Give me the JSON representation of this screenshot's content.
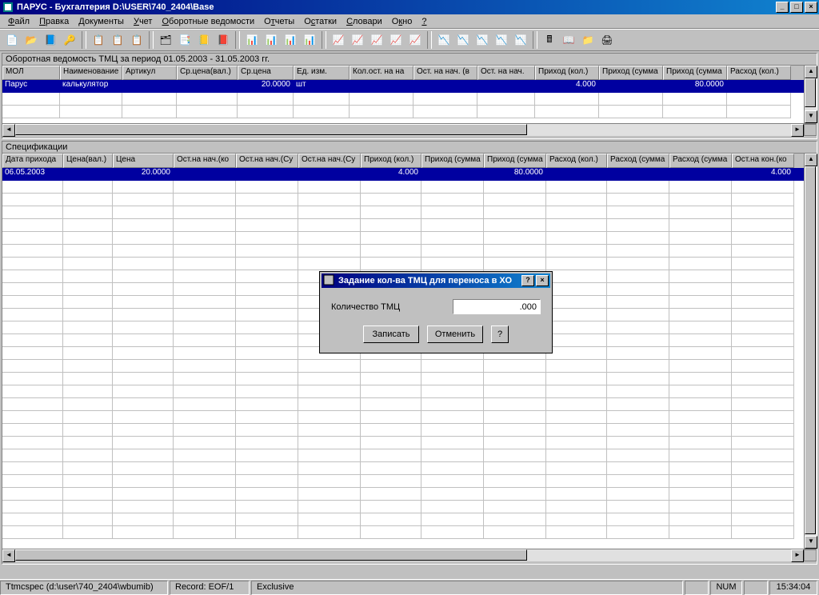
{
  "window": {
    "title": "ПАРУС - Бухгалтерия  D:\\USER\\740_2404\\Base"
  },
  "menu": {
    "file": "Файл",
    "edit": "Правка",
    "documents": "Документы",
    "accounting": "Учет",
    "turnover": "Оборотные ведомости",
    "reports": "Отчеты",
    "balances": "Остатки",
    "dictionaries": "Словари",
    "window": "Окно",
    "help": "?"
  },
  "panel1": {
    "title": "Оборотная ведомость ТМЦ за период 01.05.2003 - 31.05.2003 гг.",
    "columns": [
      "МОЛ",
      "Наименование",
      "Артикул",
      "Ср.цена(вал.)",
      "Ср.цена",
      "Ед. изм.",
      "Кол.ост. на на",
      "Ост. на нач. (в",
      "Ост. на нач.",
      "Приход (кол.)",
      "Приход (сумма",
      "Приход (сумма",
      "Расход (кол.)"
    ],
    "row": {
      "mol": "Парус",
      "name": "калькулятор",
      "artikul": "",
      "avgpricecur": "",
      "avgprice": "20.0000",
      "unit": "шт",
      "qtystart": "",
      "startcur": "",
      "start": "",
      "incqty": "4.000",
      "incsumcur": "",
      "incsum": "80.0000",
      "outqty": ""
    }
  },
  "panel2": {
    "title": "Спецификации",
    "columns": [
      "Дата прихода",
      "Цена(вал.)",
      "Цена",
      "Ост.на нач.(ко",
      "Ост.на нач.(Су",
      "Ост.на нач.(Су",
      "Приход (кол.)",
      "Приход (сумма",
      "Приход (сумма",
      "Расход (кол.)",
      "Расход (сумма",
      "Расход (сумма",
      "Ост.на кон.(ко"
    ],
    "row": {
      "date": "06.05.2003",
      "pricecur": "",
      "price": "20.0000",
      "startqty": "",
      "startsumcur": "",
      "startsum": "",
      "incqty": "4.000",
      "incsumcur": "",
      "incsum": "80.0000",
      "outqty": "",
      "outsumcur": "",
      "outsum": "",
      "endqty": "4.000"
    }
  },
  "dialog": {
    "title": "Задание кол-ва ТМЦ для переноса в ХО",
    "label": "Количество ТМЦ",
    "value": ".000",
    "save": "Записать",
    "cancel": "Отменить",
    "help": "?"
  },
  "status": {
    "path": "Ttmcspec (d:\\user\\740_2404\\wbumib)",
    "record": "Record: EOF/1",
    "mode": "Exclusive",
    "num": "NUM",
    "time": "15:34:04"
  }
}
